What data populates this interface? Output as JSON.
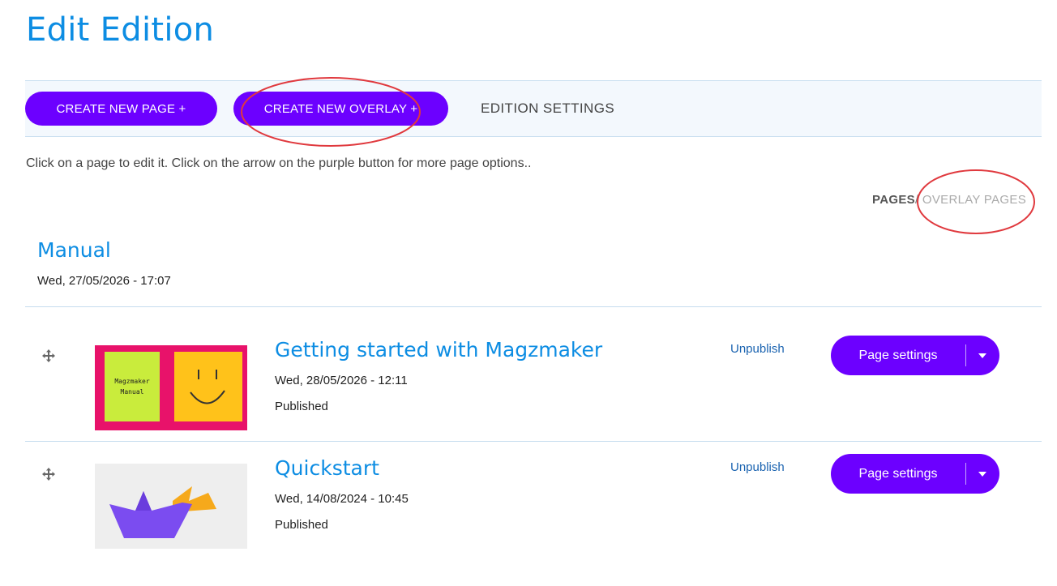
{
  "page": {
    "title": "Edit Edition"
  },
  "toolbar": {
    "create_page_label": "CREATE NEW PAGE +",
    "create_overlay_label": "CREATE NEW OVERLAY +",
    "settings_label": "EDITION SETTINGS"
  },
  "instructions": "Click on a page to edit it. Click on the arrow on the purple button for more page options..",
  "view_toggle": {
    "pages_label": "PAGES",
    "separator": "/",
    "overlay_label": "OVERLAY PAGES"
  },
  "group": {
    "title": "Manual",
    "date": "Wed, 27/05/2026 - 17:07"
  },
  "rows": [
    {
      "title": "Getting started with Magzmaker",
      "date": "Wed, 28/05/2026 - 12:11",
      "status": "Published",
      "unpublish_label": "Unpublish",
      "settings_label": "Page settings",
      "thumb_text_1": "Magzmaker",
      "thumb_text_2": "Manual"
    },
    {
      "title": "Quickstart",
      "date": "Wed, 14/08/2024 - 10:45",
      "status": "Published",
      "unpublish_label": "Unpublish",
      "settings_label": "Page settings"
    }
  ],
  "icons": {
    "drag": "move-arrows-icon",
    "caret": "chevron-down-icon"
  },
  "colors": {
    "accent_blue": "#0d8de3",
    "button_purple": "#6c00ff",
    "annotation_red": "#e0393e"
  }
}
